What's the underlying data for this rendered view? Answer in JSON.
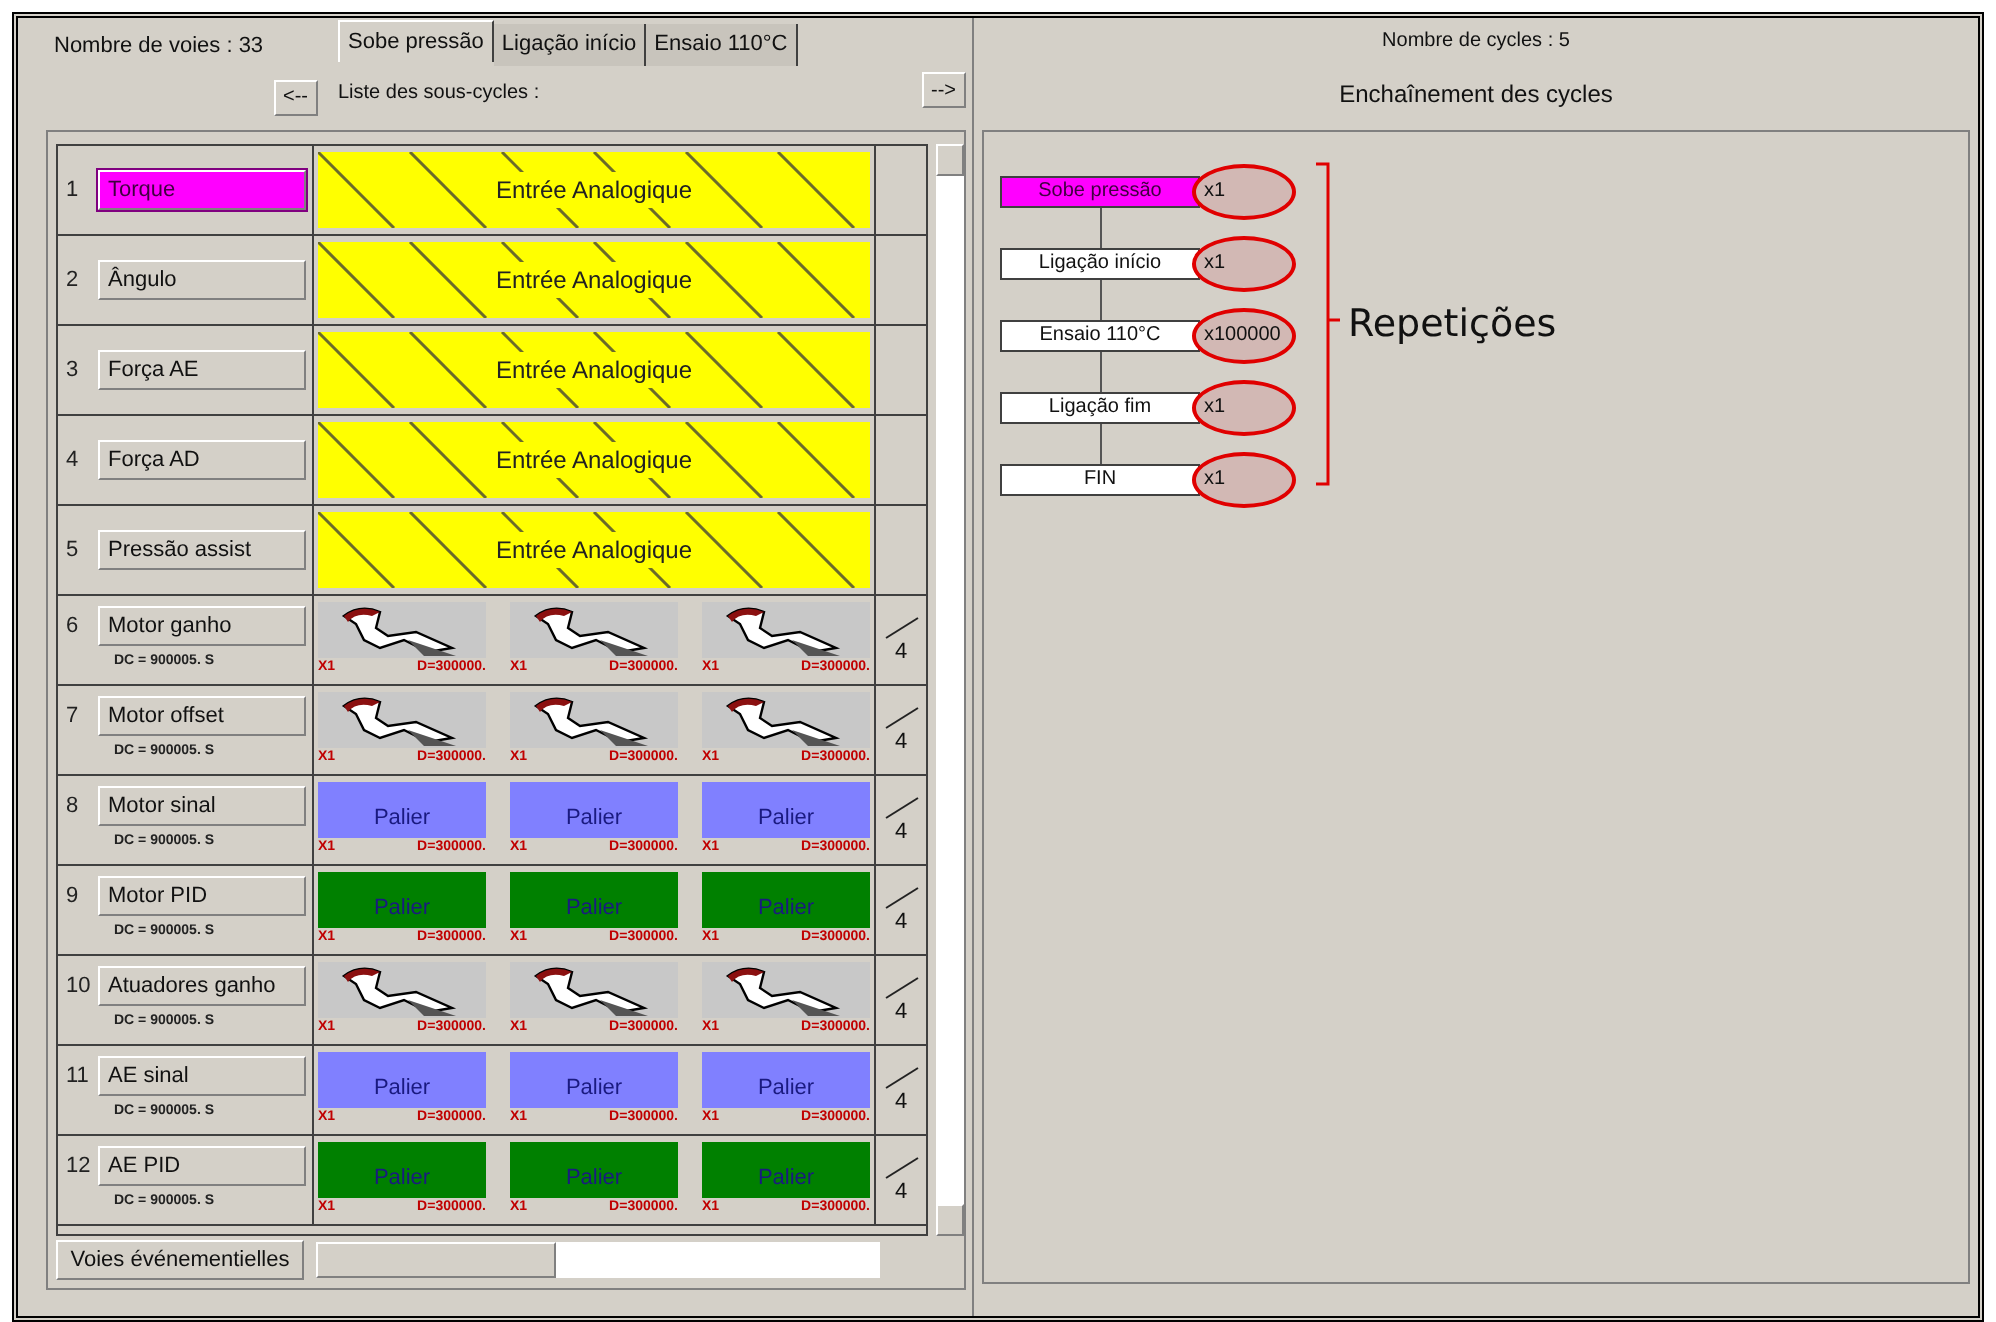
{
  "left": {
    "channel_count": "Nombre de voies : 33",
    "tabs": [
      {
        "label": "Sobe pressão",
        "selected": true
      },
      {
        "label": "Ligação início",
        "selected": false
      },
      {
        "label": "Ensaio 110°C",
        "selected": false
      }
    ],
    "prev_button": "<--",
    "next_button": "-->",
    "subcycles_label": "Liste des sous-cycles :",
    "channels": [
      {
        "number": "1",
        "name": "Torque",
        "selected": true,
        "kind": "analog",
        "label": "Entrée Analogique"
      },
      {
        "number": "2",
        "name": "Ângulo",
        "selected": false,
        "kind": "analog",
        "label": "Entrée Analogique"
      },
      {
        "number": "3",
        "name": "Força AE",
        "selected": false,
        "kind": "analog",
        "label": "Entrée Analogique"
      },
      {
        "number": "4",
        "name": "Força AD",
        "selected": false,
        "kind": "analog",
        "label": "Entrée Analogique"
      },
      {
        "number": "5",
        "name": "Pressão assist",
        "selected": false,
        "kind": "analog",
        "label": "Entrée Analogique"
      },
      {
        "number": "6",
        "name": "Motor ganho",
        "selected": false,
        "kind": "steps",
        "dc": "DC = 900005. S",
        "extra": "4",
        "steps": [
          {
            "kind": "ramp",
            "count": "X1",
            "duration": "D=300000."
          },
          {
            "kind": "ramp",
            "count": "X1",
            "duration": "D=300000."
          },
          {
            "kind": "ramp",
            "count": "X1",
            "duration": "D=300000."
          }
        ]
      },
      {
        "number": "7",
        "name": "Motor offset",
        "selected": false,
        "kind": "steps",
        "dc": "DC = 900005. S",
        "extra": "4",
        "steps": [
          {
            "kind": "ramp",
            "count": "X1",
            "duration": "D=300000."
          },
          {
            "kind": "ramp",
            "count": "X1",
            "duration": "D=300000."
          },
          {
            "kind": "ramp",
            "count": "X1",
            "duration": "D=300000."
          }
        ]
      },
      {
        "number": "8",
        "name": "Motor sinal",
        "selected": false,
        "kind": "steps",
        "dc": "DC = 900005. S",
        "extra": "4",
        "steps": [
          {
            "kind": "plateau",
            "label": "Palier",
            "color": "#8080ff",
            "count": "X1",
            "duration": "D=300000."
          },
          {
            "kind": "plateau",
            "label": "Palier",
            "color": "#8080ff",
            "count": "X1",
            "duration": "D=300000."
          },
          {
            "kind": "plateau",
            "label": "Palier",
            "color": "#8080ff",
            "count": "X1",
            "duration": "D=300000."
          }
        ]
      },
      {
        "number": "9",
        "name": "Motor PID",
        "selected": false,
        "kind": "steps",
        "dc": "DC = 900005. S",
        "extra": "4",
        "steps": [
          {
            "kind": "plateau",
            "label": "Palier",
            "color": "#008000",
            "count": "X1",
            "duration": "D=300000."
          },
          {
            "kind": "plateau",
            "label": "Palier",
            "color": "#008000",
            "count": "X1",
            "duration": "D=300000."
          },
          {
            "kind": "plateau",
            "label": "Palier",
            "color": "#008000",
            "count": "X1",
            "duration": "D=300000."
          }
        ]
      },
      {
        "number": "10",
        "name": "Atuadores ganho",
        "selected": false,
        "kind": "steps",
        "dc": "DC = 900005. S",
        "extra": "4",
        "steps": [
          {
            "kind": "ramp",
            "count": "X1",
            "duration": "D=300000."
          },
          {
            "kind": "ramp",
            "count": "X1",
            "duration": "D=300000."
          },
          {
            "kind": "ramp",
            "count": "X1",
            "duration": "D=300000."
          }
        ]
      },
      {
        "number": "11",
        "name": "AE sinal",
        "selected": false,
        "kind": "steps",
        "dc": "DC = 900005. S",
        "extra": "4",
        "steps": [
          {
            "kind": "plateau",
            "label": "Palier",
            "color": "#8080ff",
            "count": "X1",
            "duration": "D=300000."
          },
          {
            "kind": "plateau",
            "label": "Palier",
            "color": "#8080ff",
            "count": "X1",
            "duration": "D=300000."
          },
          {
            "kind": "plateau",
            "label": "Palier",
            "color": "#8080ff",
            "count": "X1",
            "duration": "D=300000."
          }
        ]
      },
      {
        "number": "12",
        "name": "AE PID",
        "selected": false,
        "kind": "steps",
        "dc": "DC = 900005. S",
        "extra": "4",
        "steps": [
          {
            "kind": "plateau",
            "label": "Palier",
            "color": "#008000",
            "count": "X1",
            "duration": "D=300000."
          },
          {
            "kind": "plateau",
            "label": "Palier",
            "color": "#008000",
            "count": "X1",
            "duration": "D=300000."
          },
          {
            "kind": "plateau",
            "label": "Palier",
            "color": "#008000",
            "count": "X1",
            "duration": "D=300000."
          }
        ]
      }
    ],
    "events_button": "Voies événementielles"
  },
  "right": {
    "cycle_count": "Nombre de cycles : 5",
    "title": "Enchaînement des cycles",
    "cycles": [
      {
        "name": "Sobe pressão",
        "selected": true,
        "repeat": "x1"
      },
      {
        "name": "Ligação início",
        "selected": false,
        "repeat": "x1"
      },
      {
        "name": "Ensaio 110°C",
        "selected": false,
        "repeat": "x100000"
      },
      {
        "name": "Ligação fim",
        "selected": false,
        "repeat": "x1"
      },
      {
        "name": "FIN",
        "selected": false,
        "repeat": "x1"
      }
    ],
    "annotation": "Repetições"
  }
}
